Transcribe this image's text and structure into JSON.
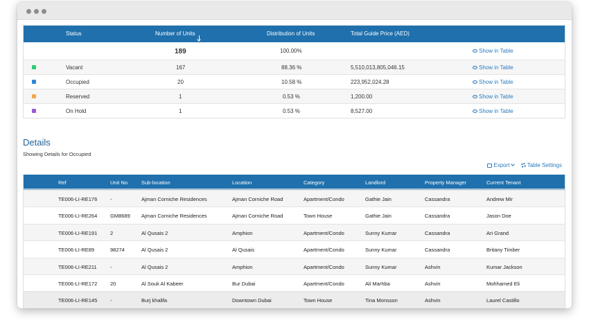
{
  "summary": {
    "headers": {
      "status": "Status",
      "units": "Number of Units",
      "distribution": "Distribution of Units",
      "price": "Total Guide Price (AED)"
    },
    "total": {
      "units": "189",
      "distribution": "100.00%",
      "action": "Show in Table"
    },
    "rows": [
      {
        "status": "Vacant",
        "units": "167",
        "distribution": "88.36 %",
        "price": "5,510,013,805,046.15",
        "action": "Show in Table",
        "color": "#2ecc71"
      },
      {
        "status": "Occupied",
        "units": "20",
        "distribution": "10.58 %",
        "price": "223,952,024.28",
        "action": "Show in Table",
        "color": "#2f86d6"
      },
      {
        "status": "Reserved",
        "units": "1",
        "distribution": "0.53 %",
        "price": "1,200.00",
        "action": "Show in Table",
        "color": "#f0a74f"
      },
      {
        "status": "On Hold",
        "units": "1",
        "distribution": "0.53 %",
        "price": "8,527.00",
        "action": "Show in Table",
        "color": "#9b59d6"
      }
    ]
  },
  "details": {
    "title": "Details",
    "subtitle": "Showing Details for Occupied",
    "export_label": "Export",
    "settings_label": "Table Settings",
    "columns": {
      "ref": "Ref",
      "unit": "Unit No",
      "sub": "Sub-location",
      "loc": "Location",
      "cat": "Category",
      "land": "Landlord",
      "pm": "Property Manager",
      "ten": "Current Tenant"
    },
    "rows": [
      {
        "ref": "TE006-LI-RE176",
        "unit": "-",
        "sub": "Ajman Corniche Residences",
        "loc": "Ajman Corniche Road",
        "cat": "Apartment/Condo",
        "land": "Gathie Jain",
        "pm": "Cassandra",
        "ten": "Andrew Mir"
      },
      {
        "ref": "TE006-LI-RE264",
        "unit": "GM8689",
        "sub": "Ajman Corniche Residences",
        "loc": "Ajman Corniche Road",
        "cat": "Town House",
        "land": "Gathie Jain",
        "pm": "Cassandra",
        "ten": "Jason Doe"
      },
      {
        "ref": "TE006-LI-RE191",
        "unit": "2",
        "sub": "Al Qusais 2",
        "loc": "Amphion",
        "cat": "Apartment/Condo",
        "land": "Sunny Kumar",
        "pm": "Cassandra",
        "ten": "Ari Grand"
      },
      {
        "ref": "TE006-LI-RE89",
        "unit": "98274",
        "sub": "Al Qusais 2",
        "loc": "Al Qusais",
        "cat": "Apartment/Condo",
        "land": "Sunny Kumar",
        "pm": "Cassandra",
        "ten": "Britany Timber"
      },
      {
        "ref": "TE006-LI-RE211",
        "unit": "-",
        "sub": "Al Qusais 2",
        "loc": "Amphion",
        "cat": "Apartment/Condo",
        "land": "Sunny Kumar",
        "pm": "Ashvin",
        "ten": "Kumar Jackson"
      },
      {
        "ref": "TE006-LI-RE172",
        "unit": "20",
        "sub": "Al Souk Al Kabeer",
        "loc": "Bur Dubai",
        "cat": "Apartment/Condo",
        "land": "Ali Marhba",
        "pm": "Ashvin",
        "ten": "Mohhamed Eli"
      },
      {
        "ref": "TE006-LI-RE145",
        "unit": "-",
        "sub": "Burj khalifa",
        "loc": "Downtown Dubai",
        "cat": "Town House",
        "land": "Tina Monsson",
        "pm": "Ashvin",
        "ten": "Laurel Castillo"
      }
    ]
  }
}
